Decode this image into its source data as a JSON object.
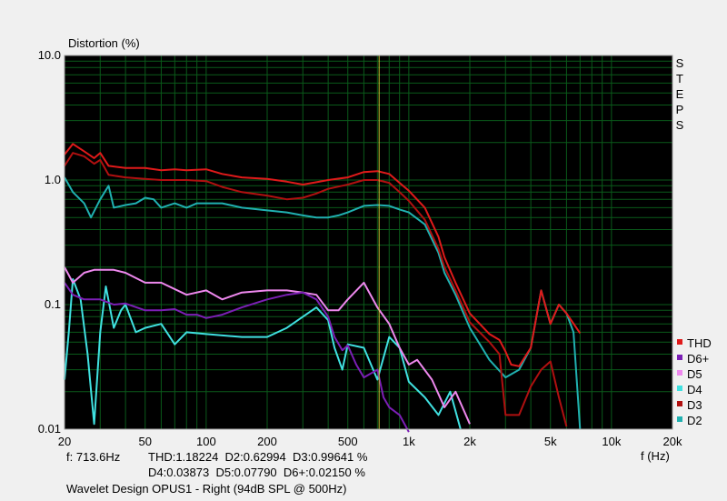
{
  "chart_data": {
    "type": "line",
    "ylabel": "Distortion (%)",
    "xlabel": "f (Hz)",
    "x_scale": "log",
    "y_scale": "log",
    "xlim": [
      20,
      20000
    ],
    "ylim": [
      0.01,
      10
    ],
    "x_ticks": [
      {
        "value": 20,
        "label": "20"
      },
      {
        "value": 50,
        "label": "50"
      },
      {
        "value": 100,
        "label": "100"
      },
      {
        "value": 200,
        "label": "200"
      },
      {
        "value": 500,
        "label": "500"
      },
      {
        "value": 1000,
        "label": "1k"
      },
      {
        "value": 2000,
        "label": "2k"
      },
      {
        "value": 5000,
        "label": "5k"
      },
      {
        "value": 10000,
        "label": "10k"
      },
      {
        "value": 20000,
        "label": "20k"
      }
    ],
    "y_ticks": [
      {
        "value": 10,
        "label": "10.0"
      },
      {
        "value": 1,
        "label": "1.0"
      },
      {
        "value": 0.1,
        "label": "0.1"
      },
      {
        "value": 0.01,
        "label": "0.01"
      }
    ],
    "grid": true,
    "background": "#000000",
    "grid_color": "#0a5a1a",
    "cursor_frequency": 713.6,
    "cursor_color": "#c8c832",
    "side_label": [
      "S",
      "T",
      "E",
      "P",
      "S"
    ],
    "legend_position": "bottom-right",
    "series": [
      {
        "name": "THD",
        "color": "#e01a1a",
        "points": [
          [
            20,
            1.6
          ],
          [
            22,
            1.95
          ],
          [
            25,
            1.7
          ],
          [
            28,
            1.5
          ],
          [
            30,
            1.65
          ],
          [
            33,
            1.3
          ],
          [
            40,
            1.25
          ],
          [
            50,
            1.25
          ],
          [
            60,
            1.2
          ],
          [
            70,
            1.22
          ],
          [
            80,
            1.2
          ],
          [
            100,
            1.22
          ],
          [
            120,
            1.12
          ],
          [
            150,
            1.05
          ],
          [
            200,
            1.02
          ],
          [
            250,
            0.97
          ],
          [
            300,
            0.92
          ],
          [
            350,
            0.96
          ],
          [
            400,
            1.0
          ],
          [
            500,
            1.05
          ],
          [
            600,
            1.16
          ],
          [
            700,
            1.18
          ],
          [
            800,
            1.12
          ],
          [
            900,
            0.95
          ],
          [
            1000,
            0.82
          ],
          [
            1200,
            0.6
          ],
          [
            1400,
            0.35
          ],
          [
            1500,
            0.24
          ],
          [
            1700,
            0.15
          ],
          [
            2000,
            0.085
          ],
          [
            2500,
            0.058
          ],
          [
            2800,
            0.052
          ],
          [
            3000,
            0.042
          ],
          [
            3200,
            0.033
          ],
          [
            3500,
            0.032
          ],
          [
            4000,
            0.045
          ],
          [
            4500,
            0.13
          ],
          [
            5000,
            0.07
          ],
          [
            5500,
            0.1
          ],
          [
            6000,
            0.085
          ],
          [
            7000,
            0.059
          ]
        ]
      },
      {
        "name": "D6+",
        "color": "#7b1fb5",
        "points": [
          [
            20,
            0.15
          ],
          [
            22,
            0.12
          ],
          [
            25,
            0.11
          ],
          [
            30,
            0.11
          ],
          [
            35,
            0.1
          ],
          [
            40,
            0.102
          ],
          [
            50,
            0.09
          ],
          [
            60,
            0.09
          ],
          [
            70,
            0.092
          ],
          [
            80,
            0.083
          ],
          [
            90,
            0.083
          ],
          [
            100,
            0.078
          ],
          [
            120,
            0.083
          ],
          [
            150,
            0.095
          ],
          [
            200,
            0.11
          ],
          [
            250,
            0.12
          ],
          [
            300,
            0.125
          ],
          [
            350,
            0.11
          ],
          [
            400,
            0.08
          ],
          [
            430,
            0.055
          ],
          [
            470,
            0.043
          ],
          [
            500,
            0.047
          ],
          [
            550,
            0.033
          ],
          [
            600,
            0.026
          ],
          [
            700,
            0.03
          ],
          [
            750,
            0.018
          ],
          [
            800,
            0.015
          ],
          [
            900,
            0.013
          ],
          [
            1000,
            0.0095
          ]
        ]
      },
      {
        "name": "D5",
        "color": "#ee88ee",
        "points": [
          [
            20,
            0.2
          ],
          [
            22,
            0.15
          ],
          [
            25,
            0.18
          ],
          [
            28,
            0.19
          ],
          [
            35,
            0.19
          ],
          [
            40,
            0.18
          ],
          [
            50,
            0.15
          ],
          [
            60,
            0.15
          ],
          [
            80,
            0.12
          ],
          [
            100,
            0.13
          ],
          [
            120,
            0.11
          ],
          [
            150,
            0.125
          ],
          [
            200,
            0.13
          ],
          [
            250,
            0.13
          ],
          [
            300,
            0.125
          ],
          [
            350,
            0.12
          ],
          [
            400,
            0.09
          ],
          [
            450,
            0.09
          ],
          [
            500,
            0.11
          ],
          [
            600,
            0.15
          ],
          [
            700,
            0.095
          ],
          [
            800,
            0.07
          ],
          [
            900,
            0.045
          ],
          [
            1000,
            0.033
          ],
          [
            1100,
            0.036
          ],
          [
            1300,
            0.025
          ],
          [
            1500,
            0.015
          ],
          [
            1700,
            0.02
          ],
          [
            2000,
            0.011
          ]
        ]
      },
      {
        "name": "D4",
        "color": "#40e0e0",
        "points": [
          [
            20,
            0.025
          ],
          [
            21,
            0.06
          ],
          [
            22,
            0.16
          ],
          [
            24,
            0.11
          ],
          [
            26,
            0.04
          ],
          [
            28,
            0.011
          ],
          [
            30,
            0.06
          ],
          [
            32,
            0.14
          ],
          [
            35,
            0.065
          ],
          [
            38,
            0.09
          ],
          [
            40,
            0.1
          ],
          [
            45,
            0.06
          ],
          [
            50,
            0.065
          ],
          [
            60,
            0.07
          ],
          [
            70,
            0.048
          ],
          [
            80,
            0.06
          ],
          [
            100,
            0.058
          ],
          [
            150,
            0.055
          ],
          [
            200,
            0.055
          ],
          [
            250,
            0.065
          ],
          [
            300,
            0.08
          ],
          [
            350,
            0.095
          ],
          [
            400,
            0.075
          ],
          [
            430,
            0.045
          ],
          [
            470,
            0.03
          ],
          [
            500,
            0.048
          ],
          [
            600,
            0.045
          ],
          [
            700,
            0.025
          ],
          [
            800,
            0.055
          ],
          [
            900,
            0.045
          ],
          [
            1000,
            0.024
          ],
          [
            1200,
            0.018
          ],
          [
            1400,
            0.013
          ],
          [
            1600,
            0.02
          ],
          [
            1800,
            0.01
          ]
        ]
      },
      {
        "name": "D3",
        "color": "#b01010",
        "points": [
          [
            20,
            1.3
          ],
          [
            22,
            1.65
          ],
          [
            25,
            1.55
          ],
          [
            28,
            1.35
          ],
          [
            30,
            1.45
          ],
          [
            33,
            1.1
          ],
          [
            40,
            1.05
          ],
          [
            50,
            1.02
          ],
          [
            60,
            1.0
          ],
          [
            70,
            1.0
          ],
          [
            80,
            1.0
          ],
          [
            100,
            0.98
          ],
          [
            120,
            0.88
          ],
          [
            150,
            0.8
          ],
          [
            200,
            0.75
          ],
          [
            250,
            0.7
          ],
          [
            300,
            0.72
          ],
          [
            350,
            0.78
          ],
          [
            400,
            0.85
          ],
          [
            500,
            0.92
          ],
          [
            600,
            1.0
          ],
          [
            700,
            1.0
          ],
          [
            800,
            0.95
          ],
          [
            900,
            0.8
          ],
          [
            1000,
            0.68
          ],
          [
            1200,
            0.48
          ],
          [
            1400,
            0.28
          ],
          [
            1500,
            0.2
          ],
          [
            1700,
            0.13
          ],
          [
            2000,
            0.072
          ],
          [
            2500,
            0.05
          ],
          [
            2800,
            0.04
          ],
          [
            3000,
            0.013
          ],
          [
            3500,
            0.013
          ],
          [
            4000,
            0.022
          ],
          [
            4500,
            0.03
          ],
          [
            5000,
            0.035
          ],
          [
            5500,
            0.018
          ],
          [
            6000,
            0.0105
          ]
        ]
      },
      {
        "name": "D2",
        "color": "#20b0b0",
        "points": [
          [
            20,
            1.05
          ],
          [
            22,
            0.8
          ],
          [
            25,
            0.65
          ],
          [
            27,
            0.5
          ],
          [
            30,
            0.7
          ],
          [
            33,
            0.9
          ],
          [
            35,
            0.6
          ],
          [
            40,
            0.63
          ],
          [
            45,
            0.65
          ],
          [
            50,
            0.72
          ],
          [
            55,
            0.7
          ],
          [
            60,
            0.6
          ],
          [
            70,
            0.65
          ],
          [
            80,
            0.6
          ],
          [
            90,
            0.65
          ],
          [
            100,
            0.65
          ],
          [
            120,
            0.65
          ],
          [
            150,
            0.6
          ],
          [
            200,
            0.57
          ],
          [
            250,
            0.55
          ],
          [
            300,
            0.52
          ],
          [
            350,
            0.5
          ],
          [
            400,
            0.5
          ],
          [
            450,
            0.52
          ],
          [
            500,
            0.55
          ],
          [
            600,
            0.62
          ],
          [
            700,
            0.63
          ],
          [
            800,
            0.62
          ],
          [
            900,
            0.58
          ],
          [
            1000,
            0.55
          ],
          [
            1200,
            0.44
          ],
          [
            1400,
            0.26
          ],
          [
            1500,
            0.18
          ],
          [
            1700,
            0.12
          ],
          [
            2000,
            0.065
          ],
          [
            2500,
            0.036
          ],
          [
            3000,
            0.026
          ],
          [
            3500,
            0.03
          ],
          [
            4000,
            0.045
          ],
          [
            4500,
            0.13
          ],
          [
            5000,
            0.07
          ],
          [
            5500,
            0.1
          ],
          [
            6000,
            0.085
          ],
          [
            6500,
            0.06
          ],
          [
            7000,
            0.01
          ]
        ]
      }
    ]
  },
  "readout": {
    "freq": "f: 713.6Hz",
    "line1": "THD:1.18224  D2:0.62994  D3:0.99641 %",
    "line2": "D4:0.03873  D5:0.07790  D6+:0.02150 %"
  },
  "device_title": "Wavelet Design OPUS1 - Right (94dB SPL @ 500Hz)"
}
